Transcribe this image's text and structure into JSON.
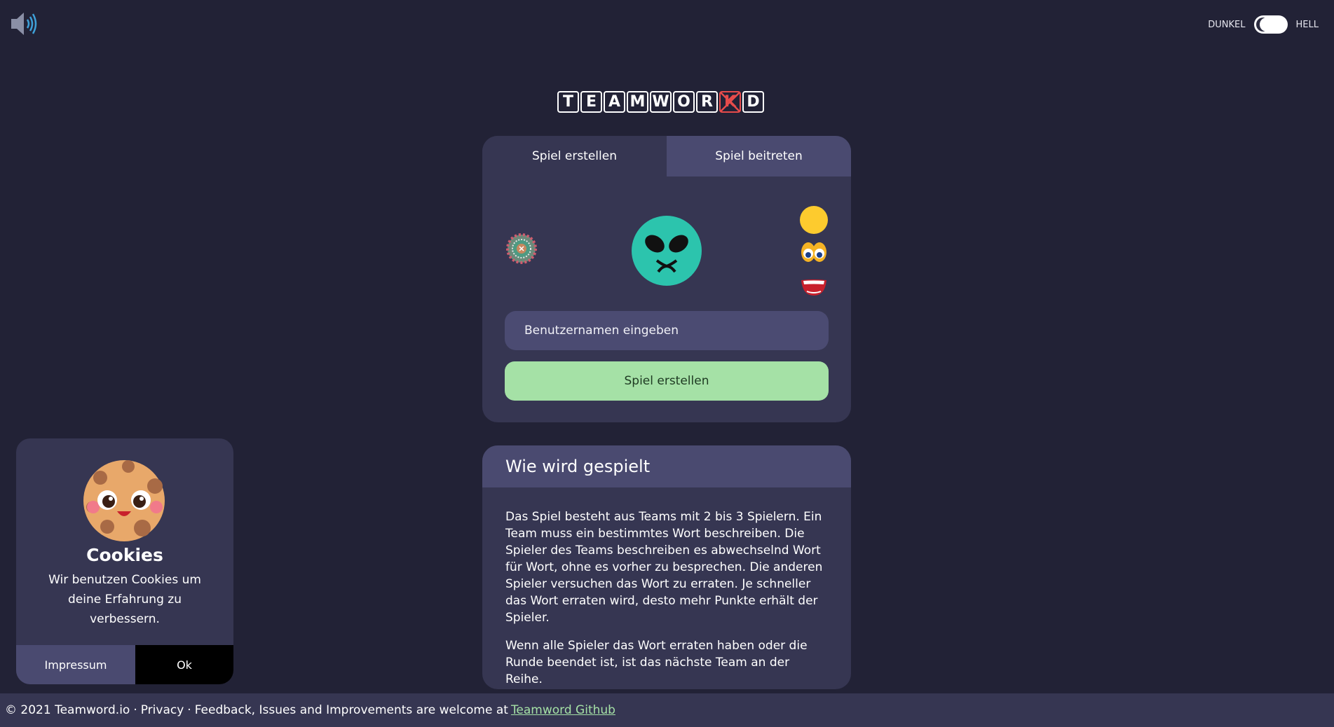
{
  "header": {
    "sound_icon": "speaker-volume-icon",
    "theme_dark_label": "DUNKEL",
    "theme_light_label": "HELL"
  },
  "logo": {
    "letters": [
      "T",
      "E",
      "A",
      "M",
      "W",
      "O",
      "R",
      "K",
      "D"
    ],
    "crossed_letter": "K"
  },
  "create_card": {
    "tabs": [
      {
        "label": "Spiel erstellen",
        "active": true
      },
      {
        "label": "Spiel beitreten",
        "active": false
      }
    ],
    "avatar_icon": "alien-avatar-icon",
    "randomize_icon": "virus-icon",
    "options": [
      "yellow-circle-icon",
      "eyes-icon",
      "mouth-icon"
    ],
    "username_placeholder": "Benutzernamen eingeben",
    "create_button": "Spiel erstellen"
  },
  "how_to_play": {
    "title": "Wie wird gespielt",
    "paragraphs": [
      "Das Spiel besteht aus Teams mit 2 bis 3 Spielern. Ein Team muss ein bestimmtes Wort beschreiben. Die Spieler des Teams beschreiben es abwechselnd Wort für Wort, ohne es vorher zu besprechen. Die anderen Spieler versuchen das Wort zu erraten. Je schneller das Wort erraten wird, desto mehr Punkte erhält der Spieler.",
      "Wenn alle Spieler das Wort erraten haben oder die Runde beendet ist, ist das nächste Team an der Reihe."
    ]
  },
  "cookie_banner": {
    "title": "Cookies",
    "text": "Wir benutzen Cookies um deine Erfahrung zu verbessern.",
    "impressum_button": "Impressum",
    "ok_button": "Ok"
  },
  "footer": {
    "copyright": "© 2021 Teamword.io",
    "privacy": "Privacy",
    "feedback": "Feedback, Issues and Improvements are welcome at",
    "github_link": "Teamword Github"
  },
  "colors": {
    "background": "#222236",
    "card": "#363652",
    "tab_inactive": "#4a4a70",
    "accent_green": "#a5e1a6",
    "avatar_teal": "#2cc4ad"
  }
}
